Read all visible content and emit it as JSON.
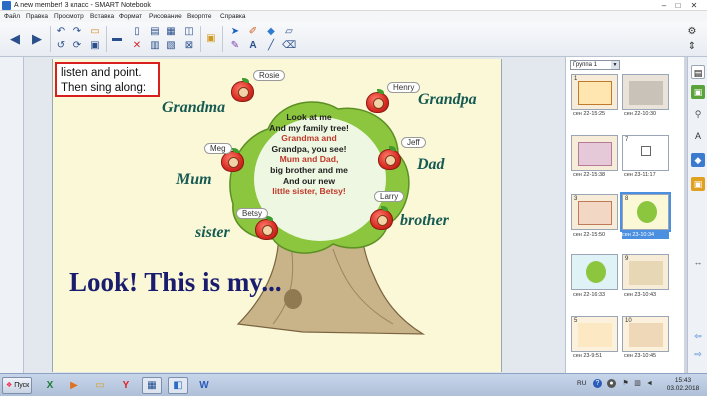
{
  "window": {
    "title": "A new member! 3 класс - SMART Notebook",
    "buttons": [
      "–",
      "□",
      "✕"
    ]
  },
  "menu": {
    "items": [
      "Файл",
      "Правка",
      "Просмотр",
      "Вставка",
      "Формат",
      "Рисование",
      "Вкорпте",
      "Справка"
    ]
  },
  "slide": {
    "instruction_line1": "listen and point.",
    "instruction_line2": "Then sing along:",
    "labels": {
      "grandma": "Grandma",
      "grandpa": "Grandpa",
      "mum": "Mum",
      "dad": "Dad",
      "sister": "sister",
      "brother": "brother"
    },
    "name_tags": {
      "rosie": "Rosie",
      "henry": "Henry",
      "meg": "Meg",
      "jeff": "Jeff",
      "betsy": "Betsy",
      "larry": "Larry"
    },
    "poem": {
      "l1": "Look at me",
      "l2": "And my family tree!",
      "l3": "Grandma and",
      "l4": "Grandpa, you see!",
      "l5": "Mum and Dad,",
      "l6": "big brother and me",
      "l7": "And our new",
      "l8": "little sister, Betsy!"
    },
    "look_text": "Look! This is my..."
  },
  "sorter": {
    "group": "Группа 1",
    "thumbnails": [
      {
        "num": "1",
        "label": "сен 22-15:25"
      },
      {
        "num": "",
        "label": "сен 22-10:30"
      },
      {
        "num": "",
        "label": "сен 22-15:38"
      },
      {
        "num": "7",
        "label": "сен 23-11:17"
      },
      {
        "num": "3",
        "label": "сен 22-15:50"
      },
      {
        "num": "8",
        "label": "сен 23-10:34"
      },
      {
        "num": "",
        "label": "сен 22-16:33"
      },
      {
        "num": "9",
        "label": "сен 23-10:43"
      },
      {
        "num": "5",
        "label": "сен 23-9:51"
      },
      {
        "num": "10",
        "label": "сен 23-10:45"
      }
    ]
  },
  "taskbar": {
    "start_label": "Пуск",
    "lang": "RU",
    "time": "15:43",
    "date": "03.02.2018"
  }
}
